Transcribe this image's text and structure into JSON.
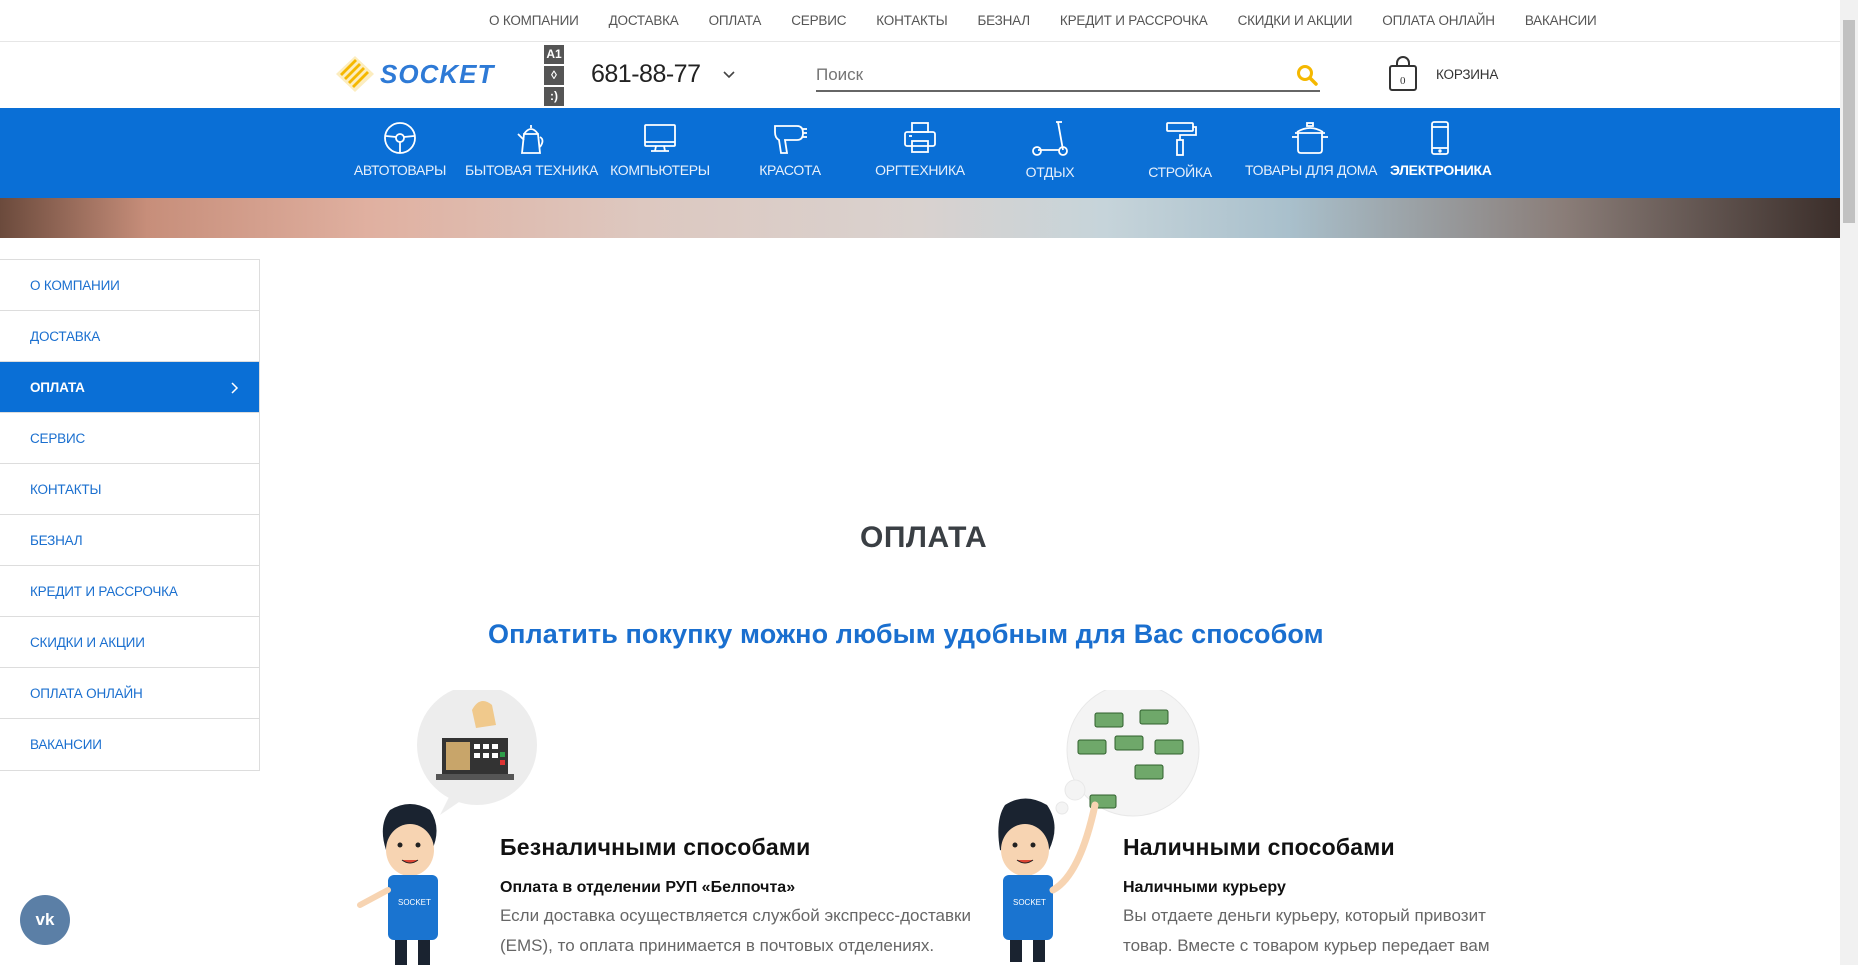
{
  "topnav": {
    "items": [
      "О КОМПАНИИ",
      "ДОСТАВКА",
      "ОПЛАТА",
      "СЕРВИС",
      "КОНТАКТЫ",
      "БЕЗНАЛ",
      "КРЕДИТ И РАССРОЧКА",
      "СКИДКИ И АКЦИИ",
      "ОПЛАТА ОНЛАЙН",
      "ВАКАНСИИ"
    ]
  },
  "header": {
    "logo_text": "SOCKET",
    "operators": [
      "A1",
      "◊",
      ":)"
    ],
    "phone": "681-88-77",
    "search_placeholder": "Поиск",
    "cart_count": "0",
    "cart_label": "КОРЗИНА"
  },
  "categories": [
    {
      "label": "АВТОТОВАРЫ",
      "icon": "steering-wheel-icon"
    },
    {
      "label": "БЫТОВАЯ ТЕХНИКА",
      "icon": "kettle-icon"
    },
    {
      "label": "КОМПЬЮТЕРЫ",
      "icon": "monitor-icon"
    },
    {
      "label": "КРАСОТА",
      "icon": "hair-dryer-icon"
    },
    {
      "label": "ОРГТЕХНИКА",
      "icon": "printer-icon"
    },
    {
      "label": "ОТДЫХ",
      "icon": "scooter-icon"
    },
    {
      "label": "СТРОЙКА",
      "icon": "paint-roller-icon"
    },
    {
      "label": "ТОВАРЫ ДЛЯ ДОМА",
      "icon": "pot-icon"
    },
    {
      "label": "ЭЛЕКТРОНИКА",
      "icon": "smartphone-icon",
      "active": true
    }
  ],
  "sidebar": {
    "items": [
      "О КОМПАНИИ",
      "ДОСТАВКА",
      "ОПЛАТА",
      "СЕРВИС",
      "КОНТАКТЫ",
      "БЕЗНАЛ",
      "КРЕДИТ И РАССРОЧКА",
      "СКИДКИ И АКЦИИ",
      "ОПЛАТА ОНЛАЙН",
      "ВАКАНСИИ"
    ],
    "active": "ОПЛАТА"
  },
  "main": {
    "title": "ОПЛАТА",
    "subtitle": "Оплатить покупку можно любым удобным для Вас способом",
    "cashless": {
      "heading": "Безналичными способами",
      "subheading": "Оплата в отделении РУП «Белпочта»",
      "text_line1": "Если доставка осуществляется службой экспресс-доставки",
      "text_line2": "(EMS), то оплата принимается в почтовых отделениях."
    },
    "cash": {
      "heading": "Наличными способами",
      "subheading": "Наличными курьеру",
      "text_line1": "Вы отдаете деньги курьеру, который привозит",
      "text_line2": "товар. Вместе с товаром курьер передает вам"
    }
  },
  "vk_label": "vk",
  "colors": {
    "brand_blue": "#0a6fd6",
    "link_blue": "#1a6fcf",
    "logo_yellow": "#f5b800"
  }
}
